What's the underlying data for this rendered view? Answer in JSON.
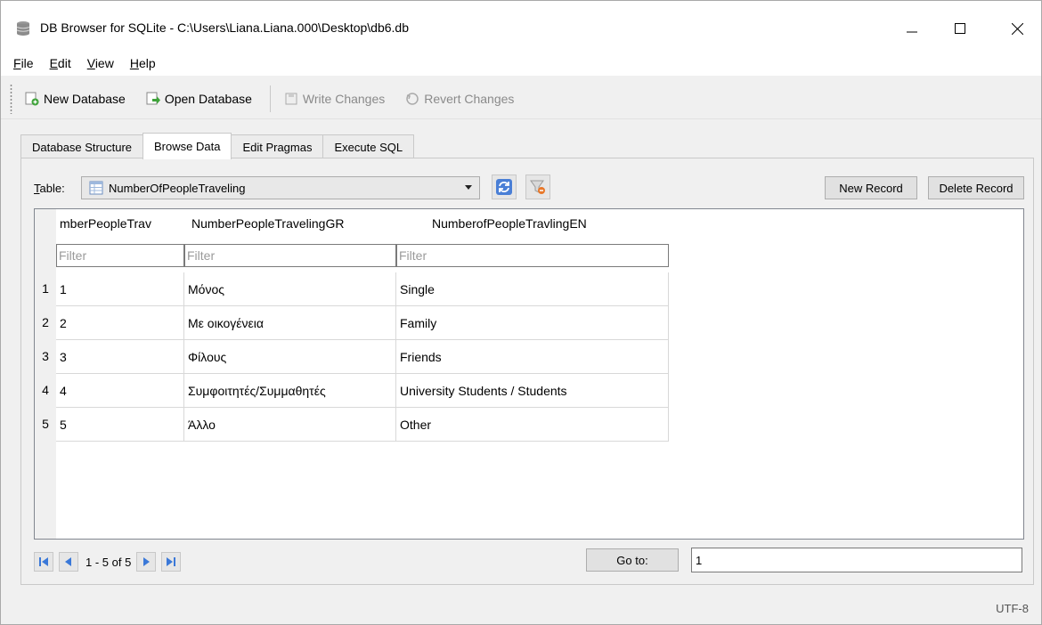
{
  "window": {
    "title": "DB Browser for SQLite - C:\\Users\\Liana.Liana.000\\Desktop\\db6.db"
  },
  "menu": {
    "items": [
      {
        "first": "F",
        "rest": "ile"
      },
      {
        "first": "E",
        "rest": "dit"
      },
      {
        "first": "V",
        "rest": "iew"
      },
      {
        "first": "H",
        "rest": "elp"
      }
    ]
  },
  "toolbar": {
    "new_database": "New Database",
    "open_database": "Open Database",
    "write_changes": "Write Changes",
    "revert_changes": "Revert Changes"
  },
  "tabs": [
    "Database Structure",
    "Browse Data",
    "Edit Pragmas",
    "Execute SQL"
  ],
  "browse": {
    "table_label_first": "T",
    "table_label_rest": "able:",
    "selected_table": "NumberOfPeopleTraveling",
    "new_record": "New Record",
    "delete_record": "Delete Record",
    "columns": [
      "mberPeopleTrav",
      "NumberPeopleTravelingGR",
      "NumberofPeopleTravlingEN"
    ],
    "filter_placeholder": "Filter",
    "rows": [
      {
        "num": "1",
        "cells": [
          "1",
          "Μόνος",
          "Single"
        ]
      },
      {
        "num": "2",
        "cells": [
          "2",
          "Με οικογένεια",
          "Family"
        ]
      },
      {
        "num": "3",
        "cells": [
          "3",
          "Φίλους",
          "Friends"
        ]
      },
      {
        "num": "4",
        "cells": [
          "4",
          "Συμφοιτητές/Συμμαθητές",
          "University Students / Students"
        ]
      },
      {
        "num": "5",
        "cells": [
          "5",
          "Άλλο",
          "Other"
        ]
      }
    ],
    "page_info": "1 - 5 of 5",
    "goto_label": "Go to:",
    "goto_value": "1"
  },
  "status": {
    "encoding": "UTF-8"
  }
}
